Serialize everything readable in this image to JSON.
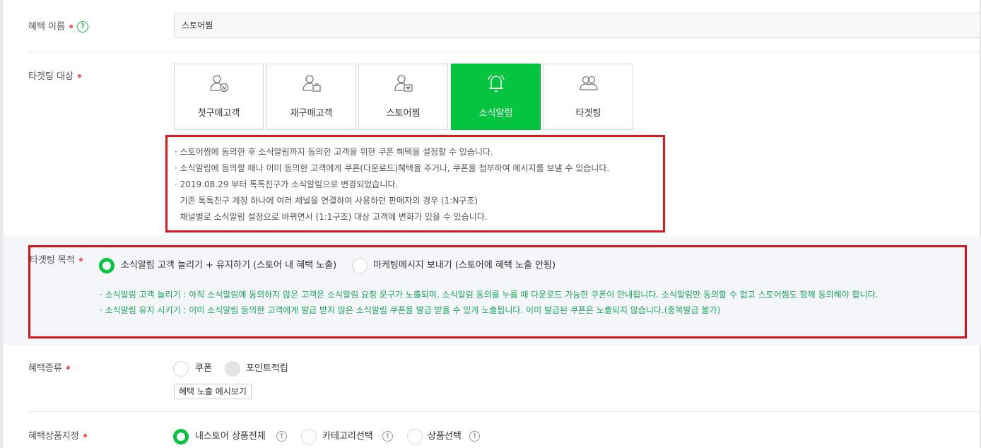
{
  "benefit_name": {
    "label": "혜택 이름",
    "value": "스토어찜"
  },
  "targeting": {
    "label": "타겟팅 대상",
    "cards": [
      {
        "label": "첫구매고객",
        "icon": "user-new-icon",
        "active": false
      },
      {
        "label": "재구매고객",
        "icon": "user-bag-icon",
        "active": false
      },
      {
        "label": "스토어찜",
        "icon": "user-heart-icon",
        "active": false
      },
      {
        "label": "소식알림",
        "icon": "bell-icon",
        "active": true
      },
      {
        "label": "타겟팅",
        "icon": "users-icon",
        "active": false
      }
    ],
    "notices": [
      "· 스토어찜에 동의한 후 소식알림까지 동의한 고객을 위한 쿠폰 혜택을 설정할 수 있습니다.",
      "· 소식알림에 동의할 때나 이미 동의한 고객에게 쿠폰(다운로드)혜택을 주거나, 쿠폰을 첨부하여 메시지를 보낼 수 있습니다.",
      "· 2019.08.29 부터 톡톡친구가 소식알림으로 변경되었습니다.",
      "  기존 톡톡친구 계정 하나에 여러 채널을 연결하여 사용하던 판매자의 경우 (1:N구조)",
      "  채널별로 소식알림 설정으로 바뀌면서 (1:1구조) 대상 고객에 변화가 있을 수 있습니다."
    ]
  },
  "purpose": {
    "label": "타겟팅 목적",
    "options": [
      {
        "label": "소식알림 고객 늘리기 + 유지하기 (스토어 내 혜택 노출)",
        "selected": true
      },
      {
        "label": "마케팅메시지 보내기 (스토어에 혜택 노출 안됨)",
        "selected": false
      }
    ],
    "descriptions": [
      "· 소식알림 고객 늘리기 : 아직 소식알림에 동의하지 않은 고객은 소식알림 요청 문구가 노출되며, 소식알림 동의를 누를 때 다운로드 가능한 쿠폰이 안내됩니다. 소식알림만 동의할 수 없고 스토어찜도 함께 동의해야 합니다.",
      "· 소식알림 유지 시키기 : 이미 소식알림 동의한 고객에게 발급 받지 않은 소식알림 쿠폰을 발급 받을 수 있게 노출됩니다. 이미 발급된 쿠폰은 노출되지 않습니다.(중복발급 불가)"
    ]
  },
  "benefit_type": {
    "label": "혜택종류",
    "options": [
      {
        "label": "쿠폰",
        "selected": false,
        "disabled": false
      },
      {
        "label": "포인트적립",
        "selected": false,
        "disabled": true
      }
    ],
    "preview_button": "혜택 노출 예시보기"
  },
  "product_scope": {
    "label": "혜택상품지정",
    "options": [
      {
        "label": "내스토어 상품전체",
        "selected": true
      },
      {
        "label": "카테고리선택",
        "selected": false
      },
      {
        "label": "상품선택",
        "selected": false
      }
    ]
  },
  "colors": {
    "accent_green": "#05c540",
    "required_dot": "#f15b5b",
    "highlight_red": "#e0161c",
    "description_green": "#1aa85a"
  }
}
